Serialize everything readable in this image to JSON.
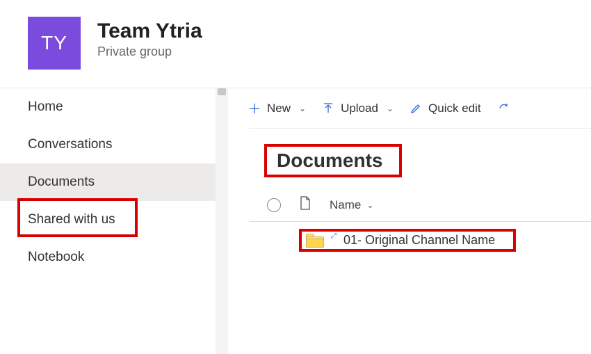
{
  "header": {
    "avatar_initials": "TY",
    "title": "Team Ytria",
    "subtitle": "Private group"
  },
  "sidebar": {
    "items": [
      {
        "label": "Home"
      },
      {
        "label": "Conversations"
      },
      {
        "label": "Documents"
      },
      {
        "label": "Shared with us"
      },
      {
        "label": "Notebook"
      }
    ],
    "selected_index": 2
  },
  "toolbar": {
    "new_label": "New",
    "upload_label": "Upload",
    "quickedit_label": "Quick edit"
  },
  "main": {
    "page_title": "Documents",
    "name_column": "Name"
  },
  "rows": [
    {
      "label": "01- Original Channel Name"
    }
  ]
}
